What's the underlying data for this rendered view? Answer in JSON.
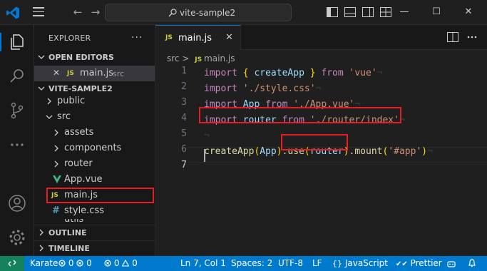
{
  "titlebar": {
    "search_text": "vite-sample2"
  },
  "sidebar": {
    "header": "EXPLORER",
    "more": "···",
    "open_editors": {
      "title": "OPEN EDITORS",
      "items": [
        {
          "file": "main.js",
          "folder": "src",
          "close": "✕",
          "badge": "JS"
        }
      ]
    },
    "project": {
      "title": "VITE-SAMPLE2",
      "items": [
        {
          "label": "public"
        },
        {
          "label": "src"
        },
        {
          "label": "assets"
        },
        {
          "label": "components"
        },
        {
          "label": "router"
        },
        {
          "label": "App.vue"
        },
        {
          "label": "main.js",
          "badge": "JS"
        },
        {
          "label": "style.css",
          "badge": "#"
        },
        {
          "label": "utils"
        }
      ]
    },
    "outline": "OUTLINE",
    "timeline": "TIMELINE"
  },
  "editor": {
    "tab": {
      "label": "main.js",
      "badge": "JS",
      "close": "✕"
    },
    "breadcrumb": {
      "folder": "src",
      "sep": ">",
      "badge": "JS",
      "file": "main.js"
    },
    "line_numbers": [
      "1",
      "2",
      "3",
      "4",
      "5",
      "6",
      "7"
    ],
    "current_line": 7
  },
  "statusbar": {
    "branch": "Karate",
    "problems_errors": "0",
    "problems_warnings": "0",
    "ports": "0",
    "info": "0",
    "position": "Ln 7, Col 1",
    "spaces": "Spaces: 2",
    "encoding": "UTF-8",
    "eol": "LF",
    "language": "JavaScript",
    "formatter": "Prettier"
  },
  "colors": {
    "accent": "#0078d4",
    "statusbar": "#007acc",
    "remote": "#16825d",
    "highlight": "#e51e25"
  }
}
